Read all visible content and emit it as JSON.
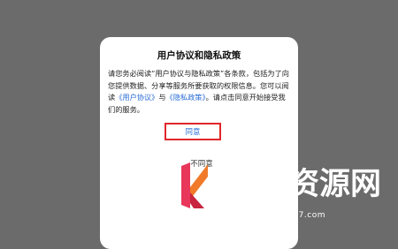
{
  "dialog": {
    "title": "用户协议和隐私政策",
    "body": {
      "part1": "请您务必阅读“用户协议与隐私政策”各条款，包括为了向您提供数据、分享等服务所要获取的权限信息。您可以阅读",
      "link1": "《用户协议》",
      "part2": "与",
      "link2": "《隐私政策》",
      "part3": "。请点击同意开始接受我们的服务。"
    },
    "agree_label": "同意",
    "disagree_label": "不同意"
  },
  "watermark": {
    "brand": "147资源网",
    "url": "no147.com"
  },
  "colors": {
    "overlay": "#6b6b6b",
    "link": "#2a6dd6",
    "highlight_border": "#e1262b"
  }
}
